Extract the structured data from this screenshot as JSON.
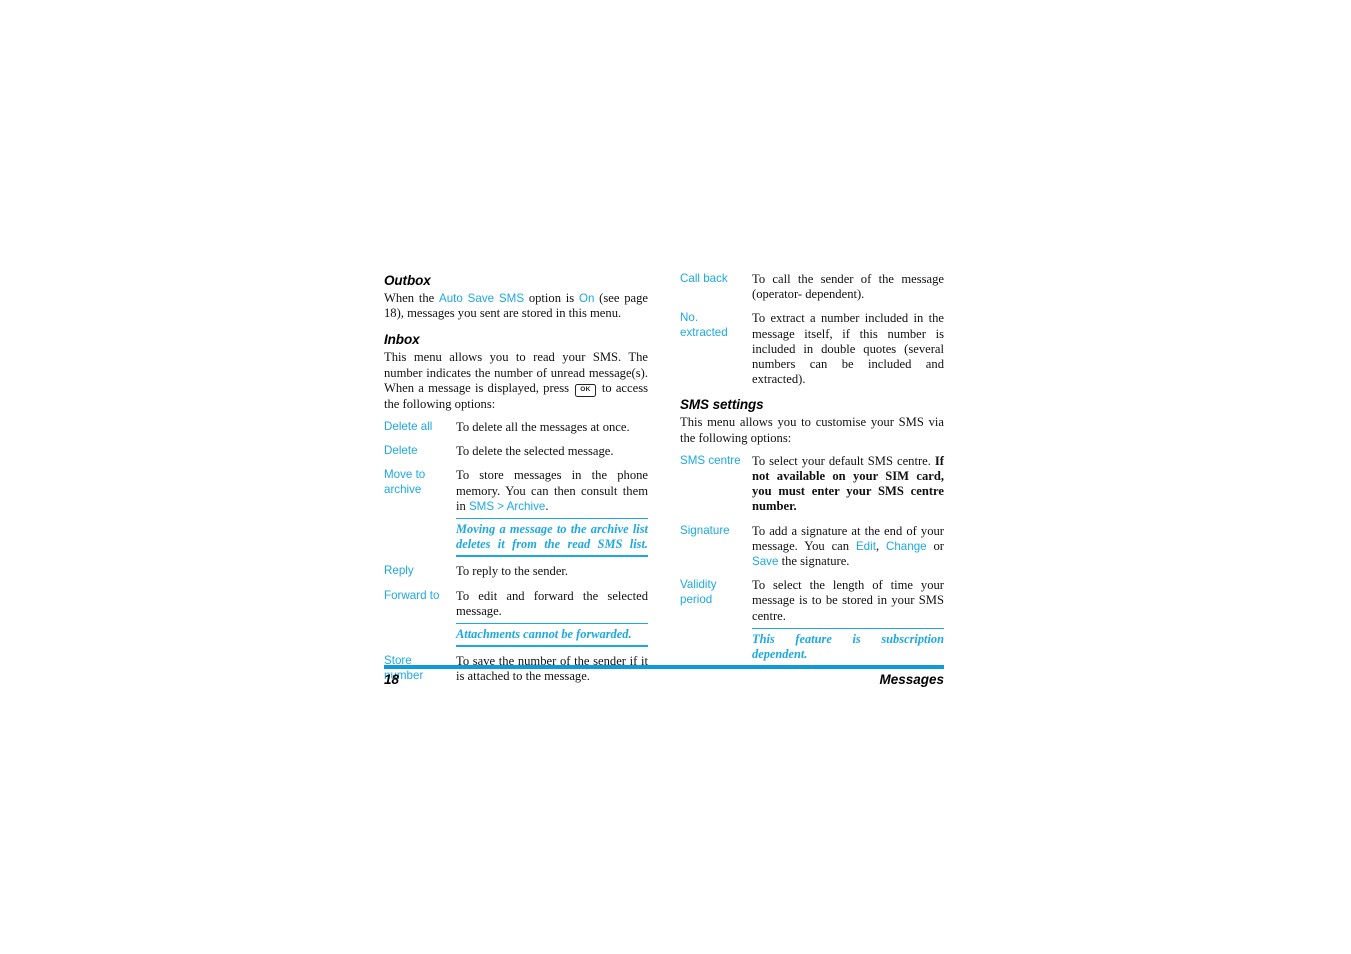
{
  "page": {
    "number": "18",
    "chapter": "Messages",
    "accent_color": "#1CA9E3",
    "rule_color": "#0E9BDB",
    "text_color": "#111111"
  },
  "left_column": {
    "outbox": {
      "heading": "Outbox",
      "para_prefix": "When the ",
      "link_auto_save": "Auto Save SMS",
      "para_mid": " option is ",
      "link_on": "On",
      "para_suffix": " (see page 18), messages you sent are stored in this menu."
    },
    "inbox": {
      "heading": "Inbox",
      "para_prefix": "This menu allows you to read your SMS. The number indicates the number of unread message(s). When a message is displayed, press ",
      "ok_key_label": "OK",
      "para_suffix": " to access the following options:",
      "options": [
        {
          "label": "Delete all",
          "desc": "To delete all the messages at once."
        },
        {
          "label": "Delete",
          "desc": "To delete the selected message."
        },
        {
          "label": "Move to archive",
          "desc_prefix": "To store messages in the phone memory. You can then consult them in ",
          "link_sms": "SMS",
          "separator": " > ",
          "link_archive": "Archive",
          "desc_suffix": ".",
          "note": "Moving a message to the archive list deletes it from the read SMS list."
        },
        {
          "label": "Reply",
          "desc": "To reply to the sender."
        },
        {
          "label": "Forward to",
          "desc": "To edit and forward the selected message.",
          "note": "Attachments cannot be forwarded."
        },
        {
          "label": "Store number",
          "desc": "To save the number of the sender if it is attached to the message."
        }
      ]
    }
  },
  "right_column": {
    "inbox_continued": [
      {
        "label": "Call back",
        "desc": "To call the sender of the message (operator- dependent)."
      },
      {
        "label": "No. extracted",
        "desc": "To extract a number included in the message itself, if this number is included in double quotes (several numbers can be included and extracted)."
      }
    ],
    "sms_settings": {
      "heading": "SMS settings",
      "intro": "This menu allows you to customise your SMS via the following options:",
      "options": [
        {
          "label": "SMS centre",
          "desc_prefix": "To select your default SMS centre. ",
          "desc_bold": "If not available on your SIM card, you must enter your SMS centre number."
        },
        {
          "label": "Signature",
          "desc_prefix": "To add a signature at the end of your message. You can ",
          "link_edit": "Edit",
          "comma": ", ",
          "link_change": "Change",
          "or": " or ",
          "link_save": "Save",
          "desc_suffix": " the signature."
        },
        {
          "label": "Validity period",
          "desc": "To select the length of time your message is to be stored in your SMS centre.",
          "note": "This feature is subscription dependent."
        }
      ]
    }
  }
}
